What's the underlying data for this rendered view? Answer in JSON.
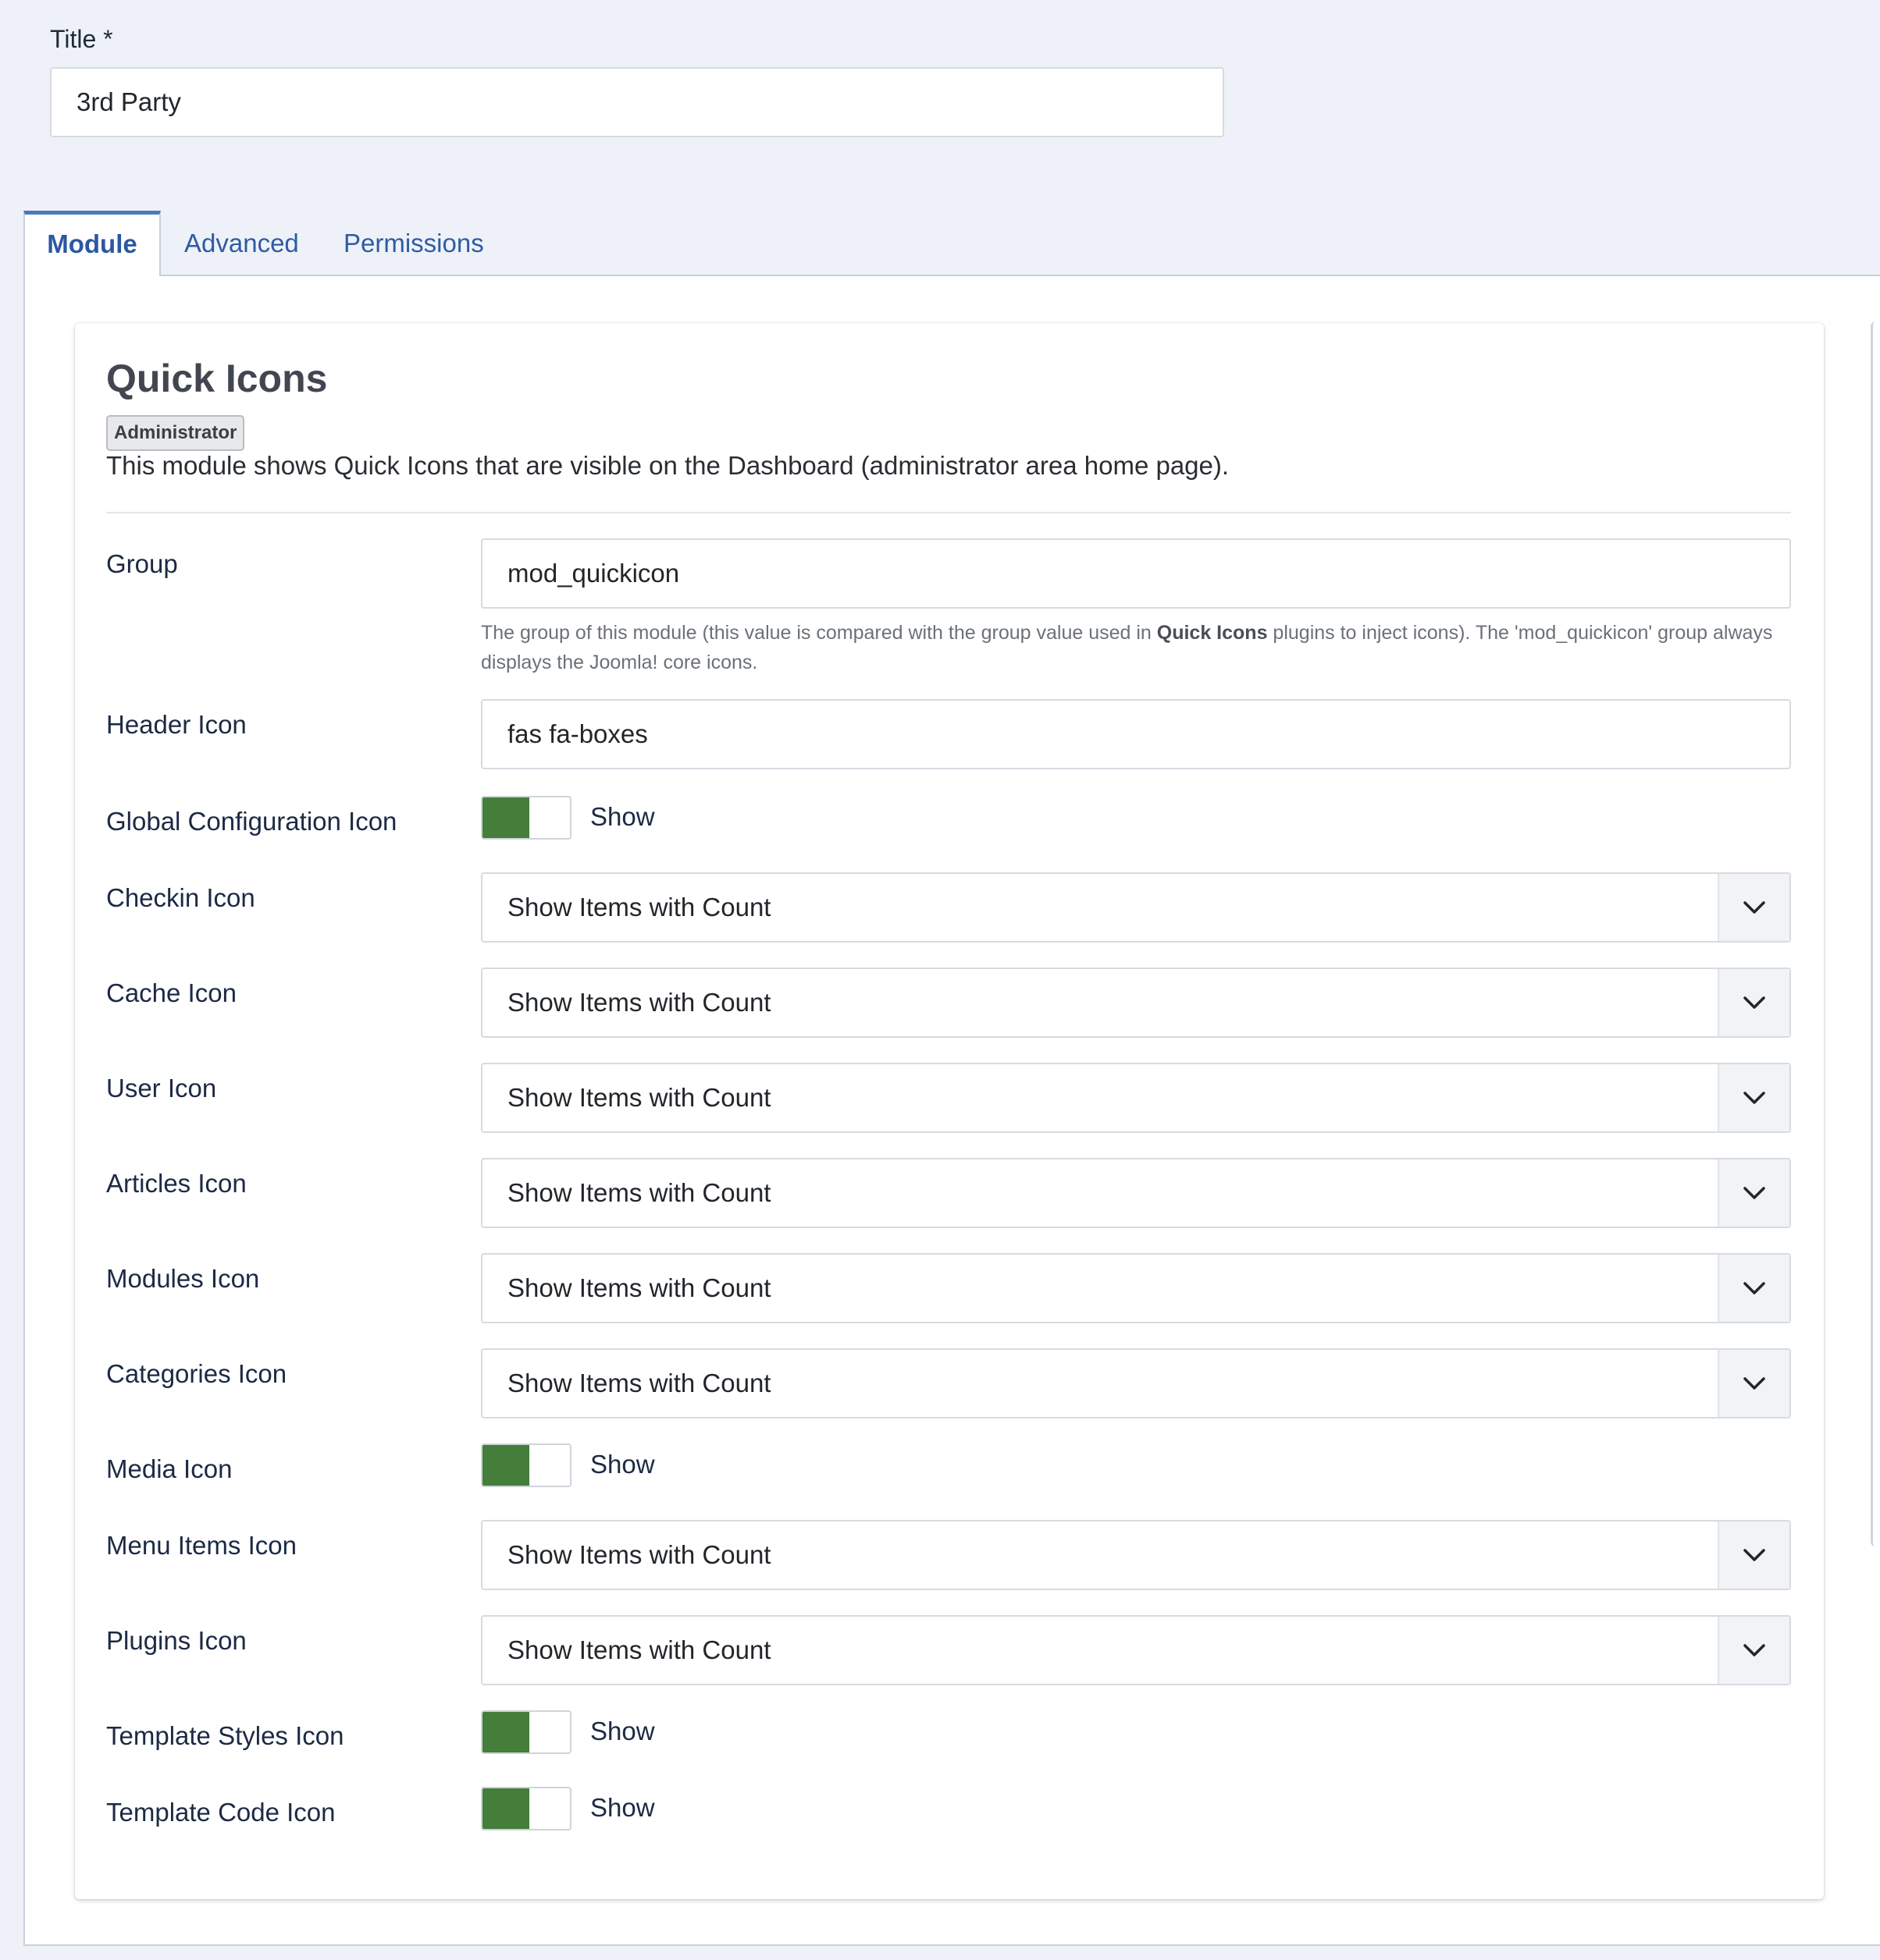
{
  "title_field": {
    "label": "Title *",
    "value": "3rd Party"
  },
  "tabs": [
    {
      "label": "Module",
      "active": true
    },
    {
      "label": "Advanced",
      "active": false
    },
    {
      "label": "Permissions",
      "active": false
    }
  ],
  "card": {
    "title": "Quick Icons",
    "badge": "Administrator",
    "description": "This module shows Quick Icons that are visible on the Dashboard (administrator area home page)."
  },
  "fields": {
    "group": {
      "label": "Group",
      "value": "mod_quickicon",
      "help_1": "The group of this module (this value is compared with the group value used in ",
      "help_bold": "Quick Icons",
      "help_2": " plugins to inject icons). The 'mod_quickicon' group always displays the Joomla! core icons."
    },
    "header_icon": {
      "label": "Header Icon",
      "value": "fas fa-boxes"
    },
    "global_config_icon": {
      "label": "Global Configuration Icon",
      "value": "Show"
    },
    "checkin_icon": {
      "label": "Checkin Icon",
      "value": "Show Items with Count"
    },
    "cache_icon": {
      "label": "Cache Icon",
      "value": "Show Items with Count"
    },
    "user_icon": {
      "label": "User Icon",
      "value": "Show Items with Count"
    },
    "articles_icon": {
      "label": "Articles Icon",
      "value": "Show Items with Count"
    },
    "modules_icon": {
      "label": "Modules Icon",
      "value": "Show Items with Count"
    },
    "categories_icon": {
      "label": "Categories Icon",
      "value": "Show Items with Count"
    },
    "media_icon": {
      "label": "Media Icon",
      "value": "Show"
    },
    "menu_items_icon": {
      "label": "Menu Items Icon",
      "value": "Show Items with Count"
    },
    "plugins_icon": {
      "label": "Plugins Icon",
      "value": "Show Items with Count"
    },
    "template_styles_icon": {
      "label": "Template Styles Icon",
      "value": "Show"
    },
    "template_code_icon": {
      "label": "Template Code Icon",
      "value": "Show"
    }
  },
  "colors": {
    "toggle_on": "#457d3a",
    "tab_active": "#2c57a0",
    "tab_accent": "#4b78c0"
  }
}
